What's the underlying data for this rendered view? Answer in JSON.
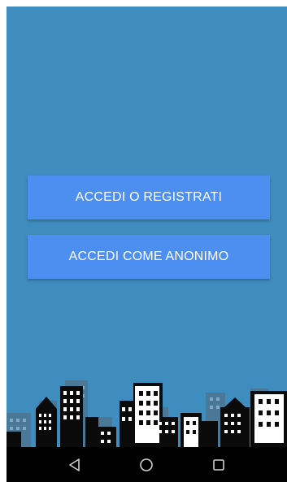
{
  "buttons": {
    "login_register": "ACCEDI O REGISTRATI",
    "anonymous": "ACCEDI COME ANONIMO"
  },
  "colors": {
    "background": "#3f8cbf",
    "button": "#4d8ff0",
    "skyline_dark": "#0a0a0a",
    "skyline_light": "#ffffff",
    "skyline_far": "#4a7896",
    "navbar": "#000000"
  },
  "navbar": {
    "icons": [
      "back-icon",
      "home-icon",
      "recents-icon"
    ]
  }
}
